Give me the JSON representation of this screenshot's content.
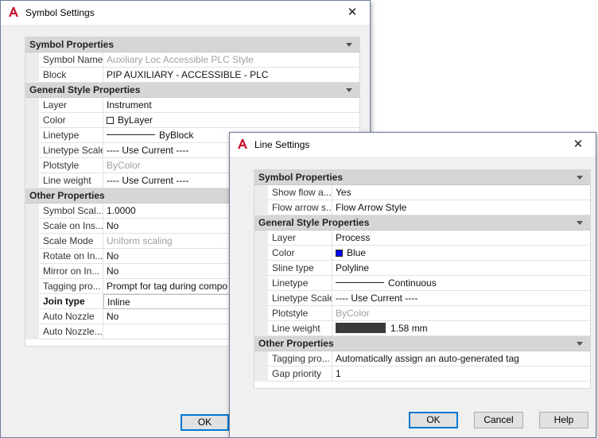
{
  "symbol_dialog": {
    "title": "Symbol Settings",
    "close_glyph": "✕",
    "categories": [
      {
        "label": "Symbol Properties",
        "rows": [
          {
            "name": "Symbol Name",
            "value": "Auxiliary Loc Accessible PLC Style"
          },
          {
            "name": "Block",
            "value": "PIP AUXILIARY - ACCESSIBLE - PLC"
          }
        ]
      },
      {
        "label": "General Style Properties",
        "rows": [
          {
            "name": "Layer",
            "value": "Instrument"
          },
          {
            "name": "Color",
            "value": "ByLayer"
          },
          {
            "name": "Linetype",
            "value": "ByBlock"
          },
          {
            "name": "Linetype Scale",
            "value": "---- Use Current ----"
          },
          {
            "name": "Plotstyle",
            "value": "ByColor"
          },
          {
            "name": "Line weight",
            "value": "---- Use Current ----"
          }
        ]
      },
      {
        "label": "Other Properties",
        "rows": [
          {
            "name": "Symbol Scal...",
            "value": "1.0000"
          },
          {
            "name": "Scale on Ins...",
            "value": "No"
          },
          {
            "name": "Scale Mode",
            "value": "Uniform scaling"
          },
          {
            "name": "Rotate on In...",
            "value": "No"
          },
          {
            "name": "Mirror on In...",
            "value": "No"
          },
          {
            "name": "Tagging pro...",
            "value": "Prompt for tag during compo"
          },
          {
            "name": "Join type",
            "value": "Inline"
          },
          {
            "name": "Auto Nozzle",
            "value": "No"
          },
          {
            "name": "Auto Nozzle...",
            "value": ""
          }
        ]
      }
    ],
    "ok_label": "OK"
  },
  "line_dialog": {
    "title": "Line Settings",
    "close_glyph": "✕",
    "categories": [
      {
        "label": "Symbol Properties",
        "rows": [
          {
            "name": "Show flow a...",
            "value": "Yes"
          },
          {
            "name": "Flow arrow s...",
            "value": "Flow Arrow Style"
          }
        ]
      },
      {
        "label": "General Style Properties",
        "rows": [
          {
            "name": "Layer",
            "value": "Process"
          },
          {
            "name": "Color",
            "value": "Blue"
          },
          {
            "name": "Sline type",
            "value": "Polyline"
          },
          {
            "name": "Linetype",
            "value": "Continuous"
          },
          {
            "name": "Linetype Scale",
            "value": "---- Use Current ----"
          },
          {
            "name": "Plotstyle",
            "value": "ByColor"
          },
          {
            "name": "Line weight",
            "value": "1.58 mm"
          }
        ]
      },
      {
        "label": "Other Properties",
        "rows": [
          {
            "name": "Tagging pro...",
            "value": "Automatically assign an auto-generated tag"
          },
          {
            "name": "Gap priority",
            "value": "1"
          }
        ]
      }
    ],
    "ok_label": "OK",
    "cancel_label": "Cancel",
    "help_label": "Help"
  },
  "colors": {
    "accent": "#0078d7",
    "app_icon_red": "#c8102e",
    "blue_swatch": "#0000ff",
    "bylayer_swatch": "#ffffff",
    "line_weight_bar": "#3a3a3a",
    "category_bg": "#d6d6d6"
  },
  "icons": {
    "app": "autocad-a-icon",
    "collapse": "chevron-down-icon",
    "close": "close-icon"
  }
}
